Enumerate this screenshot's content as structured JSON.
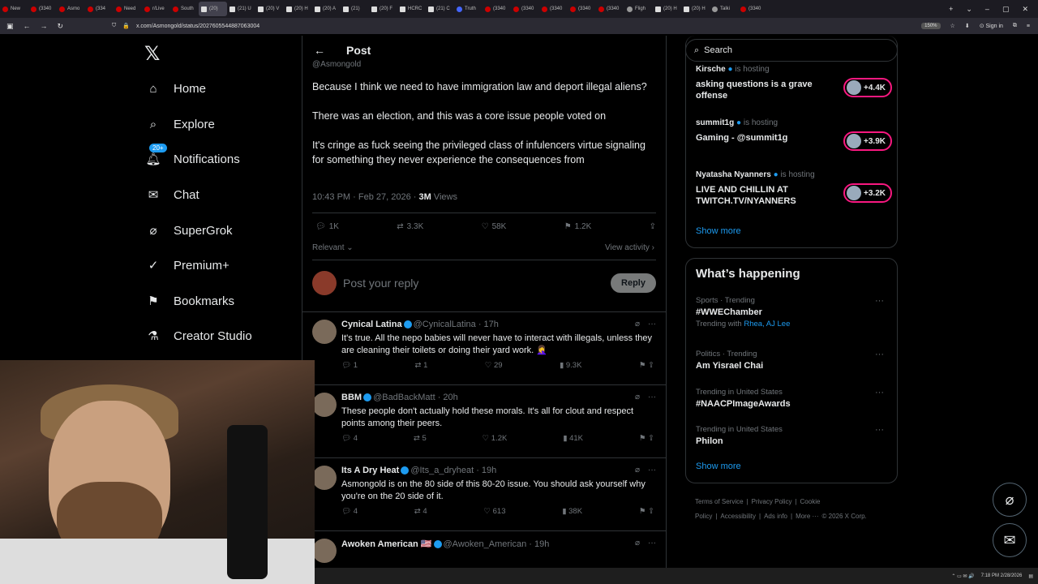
{
  "browser": {
    "tabs": [
      {
        "label": "New",
        "icon": "red"
      },
      {
        "label": "(3340",
        "icon": "red"
      },
      {
        "label": "Asmo",
        "icon": "red"
      },
      {
        "label": "(334",
        "icon": "red"
      },
      {
        "label": "Need",
        "icon": "red"
      },
      {
        "label": "r/Live",
        "icon": "red"
      },
      {
        "label": "South",
        "icon": "red"
      },
      {
        "label": "(20)",
        "icon": "x",
        "active": true
      },
      {
        "label": "(21) U",
        "icon": "x"
      },
      {
        "label": "(20) V",
        "icon": "x"
      },
      {
        "label": "(20) H",
        "icon": "x"
      },
      {
        "label": "(20) A",
        "icon": "x"
      },
      {
        "label": "(21)",
        "icon": "x"
      },
      {
        "label": "(20) F",
        "icon": "x"
      },
      {
        "label": "HCRC",
        "icon": "x"
      },
      {
        "label": "(21) C",
        "icon": "x"
      },
      {
        "label": "Truth",
        "icon": "b"
      },
      {
        "label": "(3340",
        "icon": "red"
      },
      {
        "label": "(3340",
        "icon": "red"
      },
      {
        "label": "(3340",
        "icon": "red"
      },
      {
        "label": "(3340",
        "icon": "red"
      },
      {
        "label": "(3340",
        "icon": "red"
      },
      {
        "label": "Fligh",
        "icon": "w"
      },
      {
        "label": "(20) H",
        "icon": "x"
      },
      {
        "label": "(20) H",
        "icon": "x"
      },
      {
        "label": "Talki",
        "icon": "w"
      },
      {
        "label": "(3340",
        "icon": "red"
      }
    ],
    "url": "x.com/Asmongold/status/2027605544887063004",
    "zoom": "150%",
    "sign_in": "Sign in"
  },
  "nav": {
    "logo": "𝕏",
    "items": [
      {
        "label": "Home",
        "icon": "home-icon"
      },
      {
        "label": "Explore",
        "icon": "search-icon"
      },
      {
        "label": "Notifications",
        "icon": "bell-icon",
        "badge": "20+"
      },
      {
        "label": "Chat",
        "icon": "mail-icon"
      },
      {
        "label": "SuperGrok",
        "icon": "grok-icon"
      },
      {
        "label": "Premium+",
        "icon": "verified-icon"
      },
      {
        "label": "Bookmarks",
        "icon": "bookmark-icon"
      },
      {
        "label": "Creator Studio",
        "icon": "flask-icon"
      }
    ]
  },
  "post": {
    "header_title": "Post",
    "author_partial": "@Asmongold",
    "paragraphs": [
      "Because I think we need to have immigration law and deport illegal aliens?",
      "There was an election, and this was a core issue people voted on",
      "It's cringe as fuck seeing the privileged class of infulencers virtue signaling for something they never experience the consequences from"
    ],
    "timestamp": "10:43 PM · Feb 27, 2026 · ",
    "views": "3M",
    "views_label": " Views",
    "stats": {
      "replies": "1K",
      "reposts": "3.3K",
      "likes": "58K",
      "bookmarks": "1.2K"
    },
    "sort_label": "Relevant",
    "view_activity": "View activity",
    "reply_placeholder": "Post your reply",
    "reply_button": "Reply"
  },
  "comments": [
    {
      "name": "Cynical Latina",
      "handle": "@CynicalLatina · 17h",
      "text": "It's true. All the nepo babies will never have to interact with illegals, unless they are cleaning their toilets or doing their yard work. 🤦‍♀️",
      "replies": "1",
      "reposts": "1",
      "likes": "29",
      "views": "9.3K"
    },
    {
      "name": "BBM",
      "handle": "@BadBackMatt · 20h",
      "text": "These people don't actually hold these morals. It's all for clout and respect points among their peers.",
      "replies": "4",
      "reposts": "5",
      "likes": "1.2K",
      "views": "41K"
    },
    {
      "name": "Its A Dry Heat",
      "handle": "@Its_a_dryheat · 19h",
      "text": "Asmongold is on the 80 side of this 80-20 issue. You should ask yourself why you're on the 20 side of it.",
      "replies": "4",
      "reposts": "4",
      "likes": "613",
      "views": "38K"
    },
    {
      "name": "Awoken American 🇺🇸",
      "handle": "@Awoken_American · 19h",
      "text": "",
      "replies": "",
      "reposts": "",
      "likes": "",
      "views": ""
    }
  ],
  "sidebar": {
    "search_placeholder": "Search",
    "spaces": [
      {
        "host": "Kirsche",
        "status": "is hosting",
        "title": "asking questions is a grave offense",
        "count": "+4.4K"
      },
      {
        "host": "summit1g",
        "status": "is hosting",
        "title": "Gaming - @summit1g",
        "count": "+3.9K"
      },
      {
        "host": "Nyatasha Nyanners",
        "status": "is hosting",
        "title": "LIVE AND CHILLIN AT TWITCH.TV/NYANNERS",
        "count": "+3.2K"
      }
    ],
    "spaces_show_more": "Show more",
    "happening_title": "What’s happening",
    "trends": [
      {
        "context": "Sports · Trending",
        "name": "#WWEChamber",
        "with_label": "Trending with ",
        "with": "Rhea, AJ Lee"
      },
      {
        "context": "Politics · Trending",
        "name": "Am Yisrael Chai"
      },
      {
        "context": "Trending in United States",
        "name": "#NAACPImageAwards"
      },
      {
        "context": "Trending in United States",
        "name": "Philon"
      }
    ],
    "happening_show_more": "Show more",
    "footer": [
      "Terms of Service",
      "|",
      "Privacy Policy",
      "|",
      "Cookie Policy",
      "|",
      "Accessibility",
      "|",
      "Ads info",
      "|",
      "More ···",
      "© 2026 X Corp."
    ]
  },
  "taskbar": {
    "time": "7:18 PM",
    "date": "2/28/2026"
  }
}
